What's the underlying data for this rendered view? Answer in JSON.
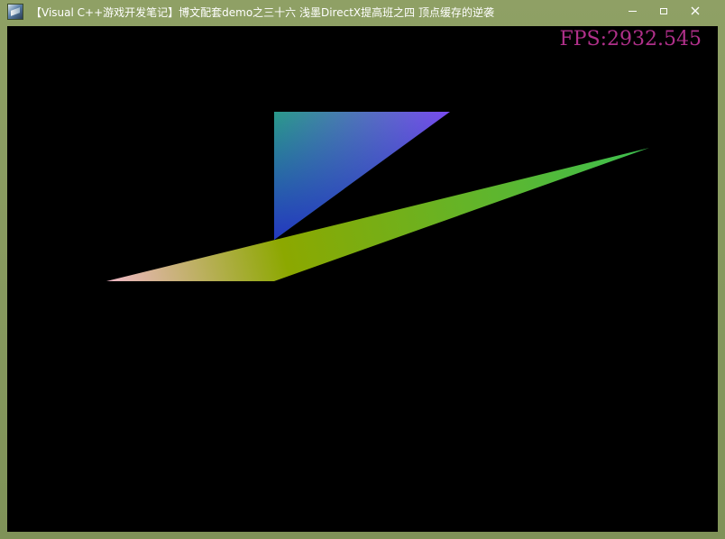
{
  "window": {
    "title": "【Visual C++游戏开发笔记】博文配套demo之三十六 浅墨DirectX提高班之四 顶点缓存的逆袭"
  },
  "caption_buttons": {
    "minimize_icon": "minimize-icon",
    "maximize_icon": "maximize-icon",
    "close_icon": "close-icon",
    "close_glyph": "✕"
  },
  "viewport": {
    "fps_text": "FPS:2932.545",
    "fps_color": "#b0308a",
    "background_color": "#000000"
  },
  "colors": {
    "tri1_top_left": "#2a9a8a",
    "tri1_top_right": "#7a4af0",
    "tri1_bottom": "#2438c0",
    "tri2_left": "#f0b8c8",
    "tri2_mid": "#8ca800",
    "tri2_right": "#3cc050"
  }
}
